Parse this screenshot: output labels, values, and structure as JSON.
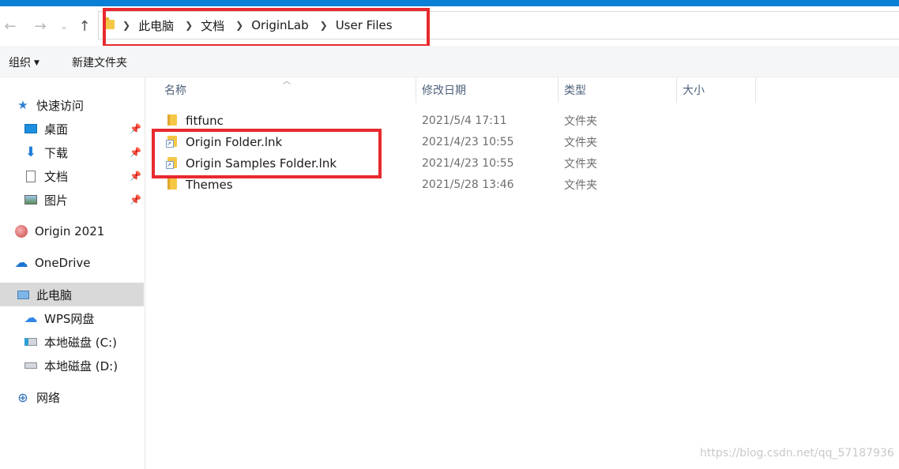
{
  "nav": {
    "back": "←",
    "forward": "→",
    "recent": "⌄",
    "up": "↑"
  },
  "breadcrumb": [
    "此电脑",
    "文档",
    "OriginLab",
    "User Files"
  ],
  "ribbon": {
    "organize": "组织",
    "new_folder": "新建文件夹"
  },
  "sidebar": {
    "quick_access": "快速访问",
    "pinned": [
      {
        "label": "桌面",
        "icon": "desktop-icon"
      },
      {
        "label": "下载",
        "icon": "download-icon"
      },
      {
        "label": "文档",
        "icon": "documents-icon"
      },
      {
        "label": "图片",
        "icon": "pictures-icon"
      }
    ],
    "origin": "Origin 2021",
    "onedrive": "OneDrive",
    "this_pc": "此电脑",
    "wps": "WPS网盘",
    "drive_c": "本地磁盘 (C:)",
    "drive_d": "本地磁盘 (D:)",
    "network": "网络"
  },
  "columns": {
    "name": "名称",
    "modified": "修改日期",
    "type": "类型",
    "size": "大小"
  },
  "files": [
    {
      "name": "fitfunc",
      "modified": "2021/5/4 17:11",
      "type": "文件夹",
      "icon": "folder-icon"
    },
    {
      "name": "Origin Folder.lnk",
      "modified": "2021/4/23 10:55",
      "type": "文件夹",
      "icon": "shortcut-icon"
    },
    {
      "name": "Origin Samples Folder.lnk",
      "modified": "2021/4/23 10:55",
      "type": "文件夹",
      "icon": "shortcut-icon"
    },
    {
      "name": "Themes",
      "modified": "2021/5/28 13:46",
      "type": "文件夹",
      "icon": "folder-icon"
    }
  ],
  "watermark": "https://blog.csdn.net/qq_57187936",
  "colors": {
    "highlight": "#e8292e",
    "accent": "#0a7fd6",
    "selected": "#d9d9d9"
  }
}
